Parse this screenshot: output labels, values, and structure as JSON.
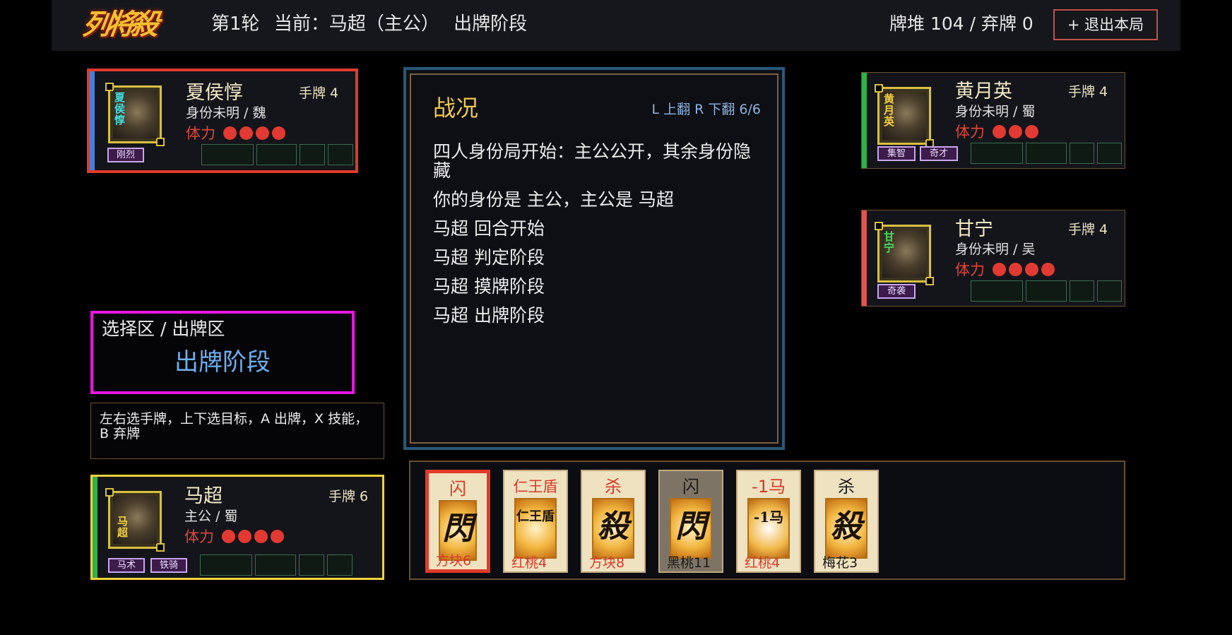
{
  "header": {
    "logo": "列将殺",
    "round": "第1轮",
    "current": "当前：马超（主公）",
    "phase": "出牌阶段",
    "pile": "牌堆 104 / 弃牌 0",
    "exit_label": "+ 退出本局"
  },
  "colors": {
    "selected_border": "#e13a2a",
    "current_turn_border": "#f0d23a",
    "select_zone_border": "#e816e0",
    "hp": "#e23a32",
    "wei": "#4a7fd8",
    "shu": "#2fb04a",
    "wu": "#e05550"
  },
  "players": {
    "xiahoudun": {
      "name": "夏侯惇",
      "portrait_text": "夏侯惇",
      "hand": "手牌 4",
      "identity": "身份未明 / 魏",
      "hp_label": "体力",
      "hp": 4,
      "max_hp": 4,
      "skills": [
        "刚烈"
      ]
    },
    "huangyueying": {
      "name": "黄月英",
      "portrait_text": "黄月英",
      "hand": "手牌 4",
      "identity": "身份未明 / 蜀",
      "hp_label": "体力",
      "hp": 3,
      "max_hp": 3,
      "skills": [
        "集智",
        "奇才"
      ]
    },
    "ganning": {
      "name": "甘宁",
      "portrait_text": "甘宁",
      "hand": "手牌 4",
      "identity": "身份未明 / 吴",
      "hp_label": "体力",
      "hp": 4,
      "max_hp": 4,
      "skills": [
        "奇袭"
      ]
    },
    "machao": {
      "name": "马超",
      "portrait_text": "马超",
      "hand": "手牌 6",
      "identity": "主公 / 蜀",
      "hp_label": "体力",
      "hp": 4,
      "max_hp": 4,
      "skills": [
        "马术",
        "铁骑"
      ]
    }
  },
  "log": {
    "title": "战况",
    "nav": "L 上翻  R 下翻  6/6",
    "lines": [
      "四人身份局开始：主公公开，其余身份隐藏",
      "你的身份是 主公，主公是 马超",
      "马超 回合开始",
      "马超 判定阶段",
      "马超 摸牌阶段",
      "马超 出牌阶段"
    ]
  },
  "select_zone": {
    "label": "选择区 / 出牌区",
    "phase": "出牌阶段"
  },
  "help": "左右选手牌，上下选目标，A 出牌，X 技能，B 弃牌",
  "hand_cards": [
    {
      "name": "闪",
      "glyph": "閃",
      "suit": "方块6",
      "color": "red",
      "selected": true
    },
    {
      "name": "仁王盾",
      "glyph": "仁王盾",
      "suit": "红桃4",
      "color": "red",
      "selected": false
    },
    {
      "name": "杀",
      "glyph": "殺",
      "suit": "方块8",
      "color": "red",
      "selected": false
    },
    {
      "name": "闪",
      "glyph": "閃",
      "suit": "黑桃11",
      "color": "black",
      "selected": false
    },
    {
      "name": "-1马",
      "glyph": "-1马",
      "suit": "红桃4",
      "color": "red",
      "selected": false
    },
    {
      "name": "杀",
      "glyph": "殺",
      "suit": "梅花3",
      "color": "black",
      "selected": false
    }
  ]
}
